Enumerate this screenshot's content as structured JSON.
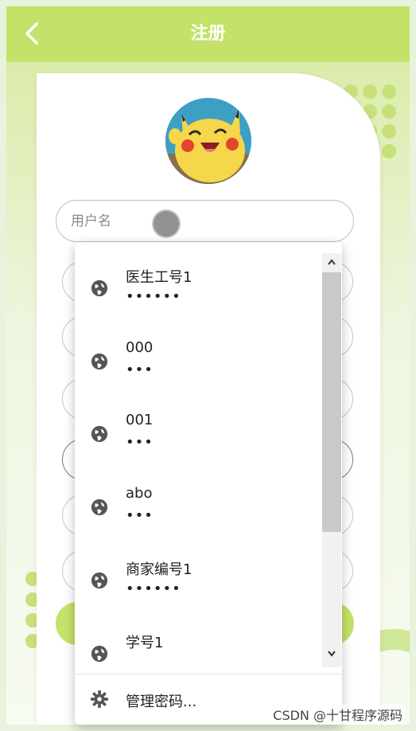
{
  "header": {
    "title": "注册",
    "back_icon": "chevron-left-icon"
  },
  "form": {
    "username_placeholder": "用户名"
  },
  "autofill": {
    "items": [
      {
        "label": "医生工号1",
        "password_mask": "••••••"
      },
      {
        "label": "000",
        "password_mask": "•••"
      },
      {
        "label": "001",
        "password_mask": "•••"
      },
      {
        "label": "abo",
        "password_mask": "•••"
      },
      {
        "label": "商家编号1",
        "password_mask": "••••••"
      },
      {
        "label": "学号1",
        "password_mask": ""
      }
    ],
    "item_icon": "globe-icon",
    "manage_label": "管理密码...",
    "manage_icon": "gear-icon"
  },
  "watermark": "CSDN @十甘程序源码",
  "colors": {
    "accent": "#c4e26a",
    "header_text": "#ffffff"
  }
}
